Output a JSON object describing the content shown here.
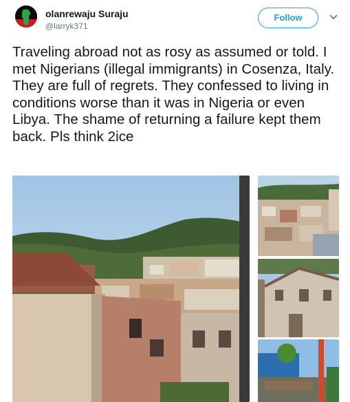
{
  "tweet": {
    "author": {
      "display_name": "olanrewaju Suraju",
      "handle": "@larryk371",
      "avatar_icon": "raised-fist-icon"
    },
    "follow_label": "Follow",
    "menu_icon": "chevron-down-icon",
    "text": "Traveling abroad not as rosy as assumed or told. I met Nigerians (illegal immigrants) in Cosenza, Italy. They are full of regrets. They confessed to living in conditions worse than it was in Nigeria or even Libya. The shame of returning a failure kept them back. Pls think 2ice"
  },
  "colors": {
    "accent": "#1da1f2",
    "text": "#14171a",
    "secondary": "#657786"
  }
}
